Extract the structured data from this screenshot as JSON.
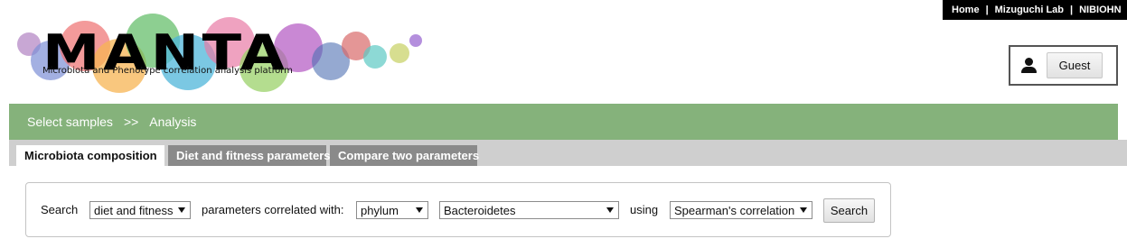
{
  "header": {
    "links": [
      {
        "label": "Home"
      },
      {
        "label": "Mizuguchi Lab"
      },
      {
        "label": "NIBIOHN"
      }
    ],
    "link_separator": "|"
  },
  "logo": {
    "title": "MANTA",
    "subtitle": "Microbiota and Phenotype correlation analysis platform"
  },
  "user": {
    "icon": "person-icon",
    "name": "Guest"
  },
  "breadcrumb": {
    "items": [
      {
        "label": "Select samples"
      },
      {
        "label": "Analysis"
      }
    ],
    "separator": ">>",
    "color": "#85b27b"
  },
  "tabs": [
    {
      "label": "Microbiota composition",
      "active": true
    },
    {
      "label": "Diet and fitness parameters",
      "active": false
    },
    {
      "label": "Compare two parameters",
      "active": false
    }
  ],
  "search_form": {
    "search_label": "Search",
    "target_select": "diet and fitness",
    "correlated_label": "parameters correlated with:",
    "rank_select": "phylum",
    "taxon_select": "Bacteroidetes",
    "using_label": "using",
    "method_select": "Spearman's correlation",
    "button_label": "Search"
  }
}
